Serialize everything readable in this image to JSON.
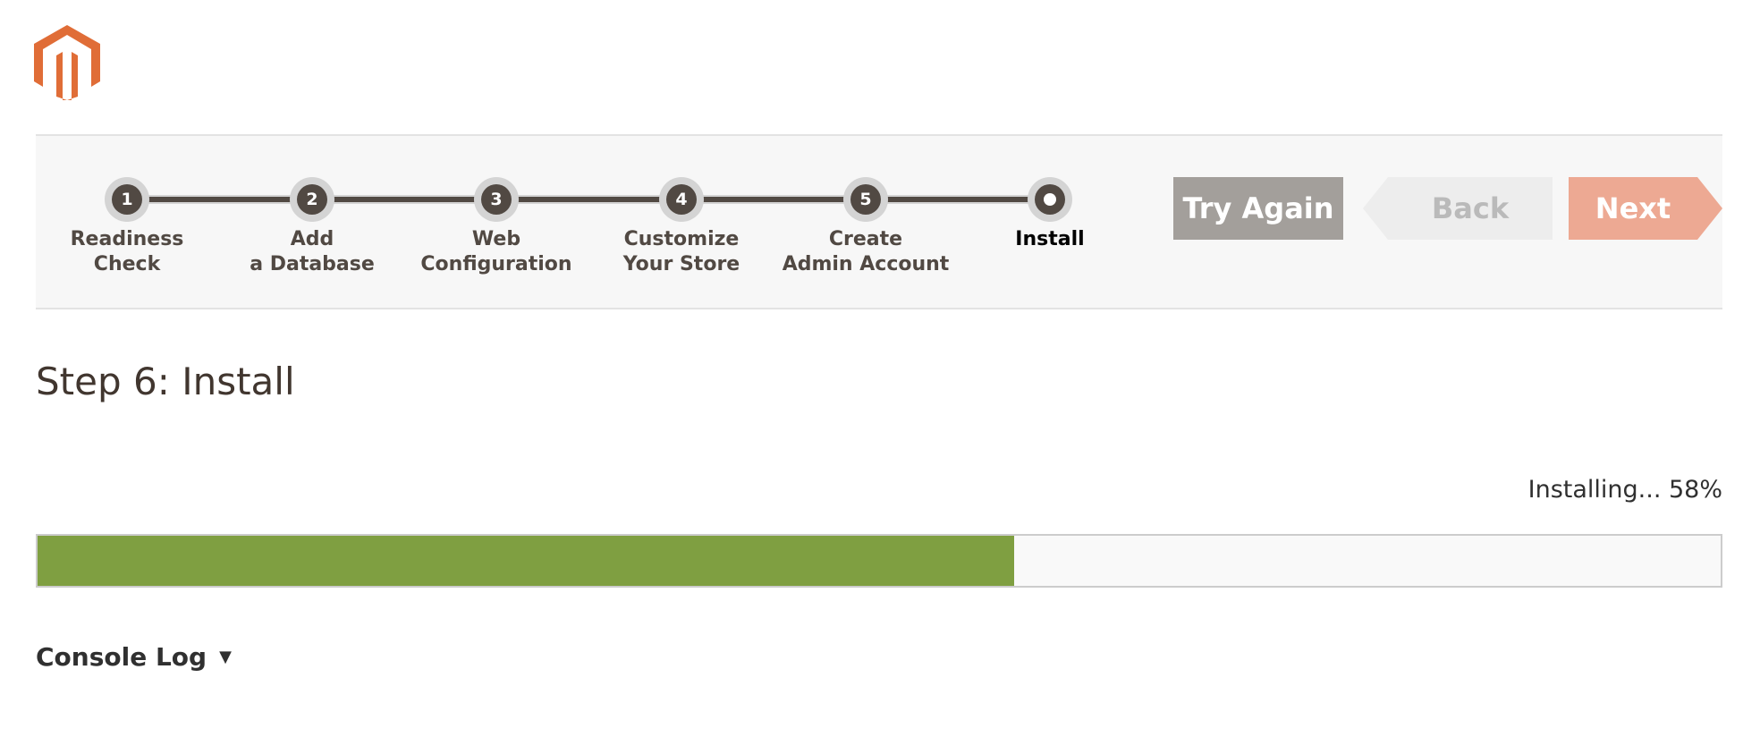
{
  "brand": {
    "logo_icon": "magento-logo-icon",
    "logo_color": "#e06d37"
  },
  "steps": [
    {
      "number": "1",
      "label_line1": "Readiness",
      "label_line2": "Check"
    },
    {
      "number": "2",
      "label_line1": "Add",
      "label_line2": "a Database"
    },
    {
      "number": "3",
      "label_line1": "Web",
      "label_line2": "Configuration"
    },
    {
      "number": "4",
      "label_line1": "Customize",
      "label_line2": "Your Store"
    },
    {
      "number": "5",
      "label_line1": "Create",
      "label_line2": "Admin Account"
    },
    {
      "number": "",
      "label_line1": "Install",
      "label_line2": ""
    }
  ],
  "current_step_index": 5,
  "nav_buttons": {
    "try_again": "Try Again",
    "back": "Back",
    "next": "Next"
  },
  "page": {
    "title": "Step 6: Install"
  },
  "progress": {
    "status_text": "Installing... 58%",
    "percent": 58,
    "fill_color": "#7f9f41"
  },
  "console": {
    "label": "Console Log",
    "caret_icon": "caret-down-icon"
  },
  "colors": {
    "step_dark": "#514943",
    "button_gray": "#a39f9b",
    "next_disabled": "#eda993",
    "back_disabled": "#ededed"
  }
}
